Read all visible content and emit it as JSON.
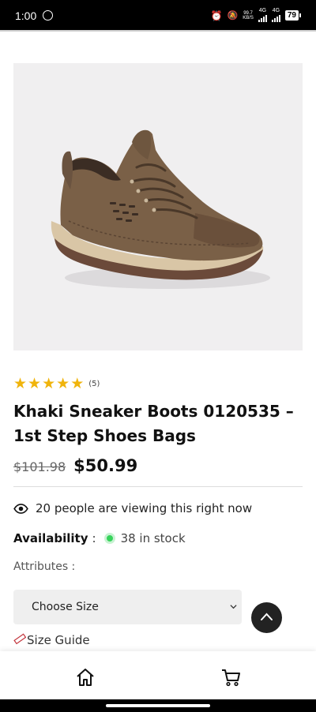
{
  "status_bar": {
    "time": "1:00",
    "data_speed_top": "99.7",
    "data_speed_bottom": "KB/S",
    "network_1": "4G",
    "network_2": "4G",
    "battery": "79"
  },
  "product": {
    "image_alt": "Khaki sneaker boot",
    "rating": {
      "stars": 5,
      "count_label": "(5)"
    },
    "title": "Khaki Sneaker Boots 0120535 – 1st Step Shoes Bags",
    "price_old": "$101.98",
    "price_new": "$50.99",
    "viewing_text": "20 people are viewing this right now",
    "availability_label": "Availability",
    "availability_colon": ":",
    "stock_text": "38 in stock",
    "attributes_label": "Attributes :",
    "size_select_value": "Choose Size",
    "size_guide_label": "Size Guide"
  },
  "colors": {
    "star": "#f0b40c",
    "stock_dot": "#37d35b"
  },
  "bottom_nav": {
    "items": [
      "home-icon",
      "cart-icon"
    ]
  }
}
